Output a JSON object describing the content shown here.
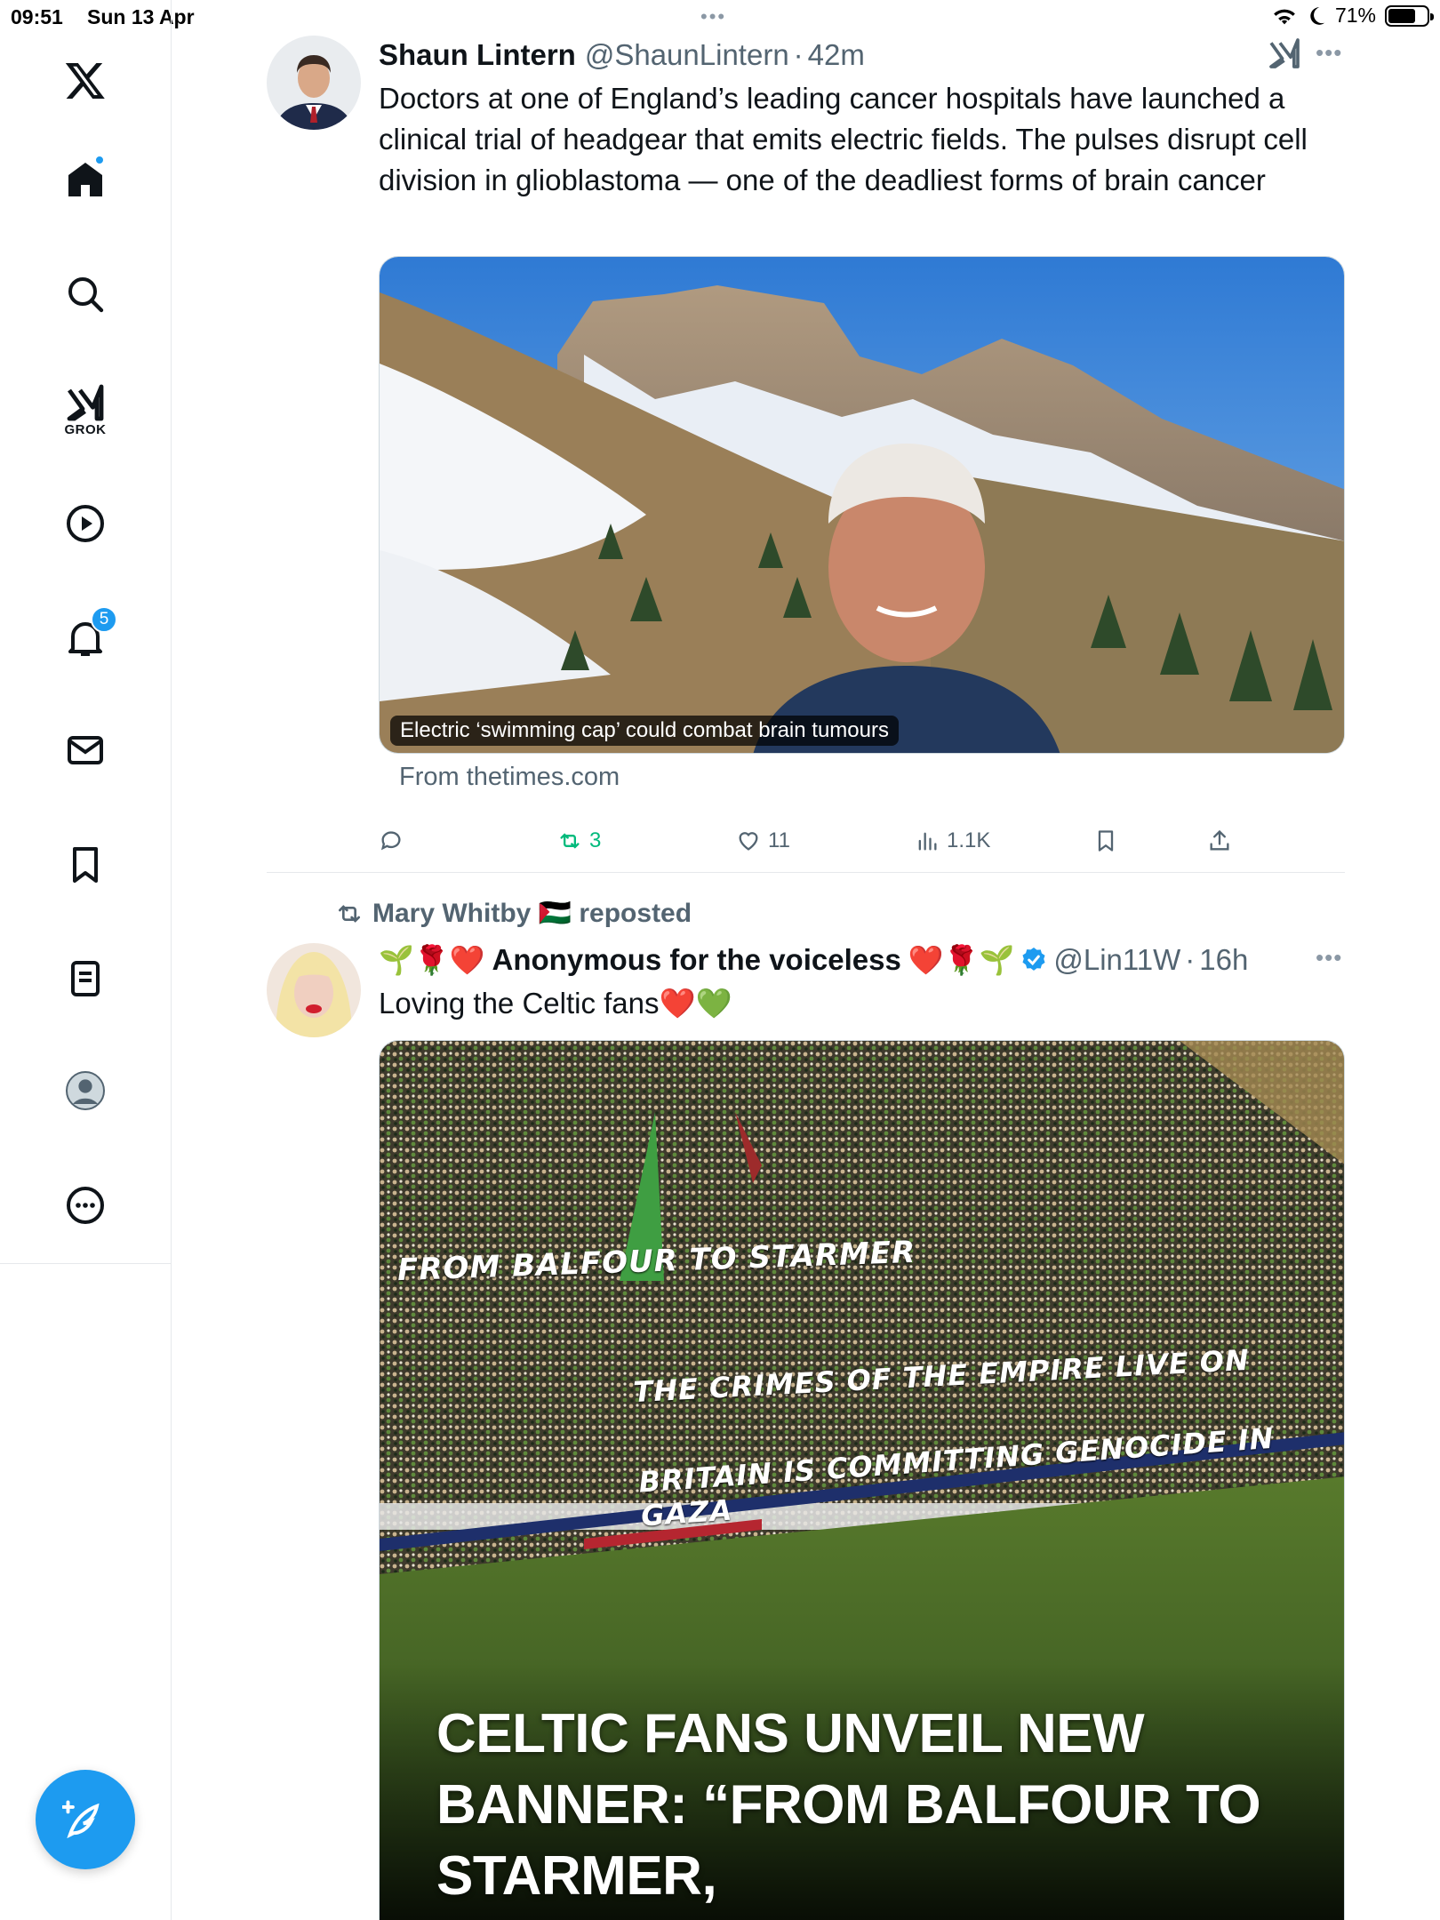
{
  "status_bar": {
    "time": "09:51",
    "date": "Sun 13 Apr",
    "battery": "71%",
    "battery_level": 0.71,
    "dots": "•••"
  },
  "sidebar": {
    "items": [
      {
        "icon": "x-logo-icon"
      },
      {
        "icon": "home-icon",
        "dot": true
      },
      {
        "icon": "search-icon"
      },
      {
        "icon": "grok-icon",
        "label": "GROK"
      },
      {
        "icon": "video-play-icon"
      },
      {
        "icon": "bell-icon",
        "badge": "5"
      },
      {
        "icon": "mail-icon"
      },
      {
        "icon": "bookmark-icon"
      },
      {
        "icon": "list-icon"
      },
      {
        "icon": "profile-icon"
      },
      {
        "icon": "more-circle-icon"
      }
    ],
    "compose_icon": "compose-feather-icon"
  },
  "posts": [
    {
      "name": "Shaun Lintern",
      "handle": "@ShaunLintern",
      "separator": "·",
      "time": "42m",
      "text": "Doctors at one of England’s leading cancer hospitals have launched a clinical trial of headgear that emits electric fields. The pulses disrupt cell division in glioblastoma — one of the deadliest forms of brain cancer",
      "card_caption": "Electric ‘swimming cap’ could combat brain tumours",
      "card_source": "From thetimes.com",
      "actions": {
        "reply": "",
        "repost": "3",
        "like": "11",
        "views": "1.1K"
      }
    },
    {
      "reposted_by": "Mary Whitby 🇵🇸 reposted",
      "name_prefix": "🌱🌹❤️",
      "name": "Anonymous for the voiceless",
      "name_suffix": "❤️🌹🌱",
      "handle": "@Lin11W",
      "separator": "·",
      "time": "16h",
      "text": "Loving the Celtic fans❤️💚",
      "image_banners": [
        "FROM BALFOUR TO STARMER",
        "THE CRIMES OF THE EMPIRE LIVE ON",
        "BRITAIN IS COMMITTING GENOCIDE IN GAZA"
      ],
      "image_headline": "CELTIC FANS UNVEIL NEW BANNER: “FROM BALFOUR TO STARMER,"
    }
  ],
  "colors": {
    "accent": "#1d9bf0",
    "repost_green": "#00ba7c",
    "muted": "#536471"
  }
}
